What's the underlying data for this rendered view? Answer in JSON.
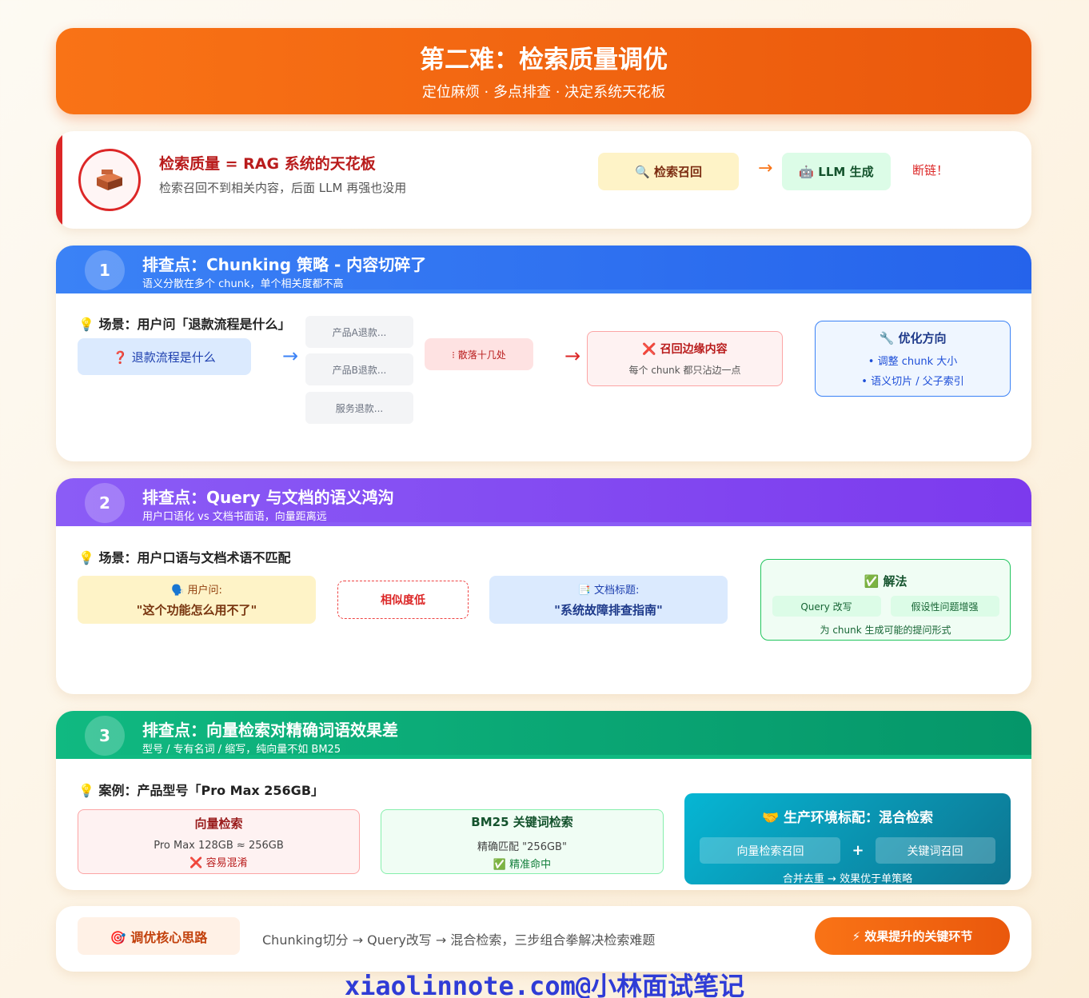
{
  "header": {
    "title": "第二难：检索质量调优",
    "subtitle": "定位麻烦 · 多点排查 · 决定系统天花板"
  },
  "intro": {
    "icon": "brick-icon",
    "title": "检索质量 = RAG 系统的天花板",
    "desc": "检索召回不到相关内容，后面 LLM 再强也没用",
    "step1": "🔍 检索召回",
    "arrow": "→",
    "step2": "🤖 LLM 生成",
    "broken": "断链！"
  },
  "sections": [
    {
      "num": "1",
      "title": "排查点：Chunking 策略 - 内容切碎了",
      "subtitle": "语义分散在多个 chunk，单个相关度都不高",
      "scene": "💡 场景：用户问「退款流程是什么」",
      "question": "❓ 退款流程是什么",
      "arrow1": "→",
      "fragments": [
        "产品A退款...",
        "产品B退款...",
        "服务退款..."
      ],
      "scatter": "⁝ 散落十几处",
      "arrow2": "→",
      "result_title": "❌ 召回边缘内容",
      "result_desc": "每个 chunk 都只沾边一点",
      "opt_title": "🔧 优化方向",
      "opt_items": [
        "• 调整 chunk 大小",
        "• 语义切片 / 父子索引"
      ]
    },
    {
      "num": "2",
      "title": "排查点：Query 与文档的语义鸿沟",
      "subtitle": "用户口语化 vs 文档书面语，向量距离远",
      "scene": "💡 场景：用户口语与文档术语不匹配",
      "user_label": "🗣️ 用户问:",
      "user_q": "\"这个功能怎么用不了\"",
      "low": "相似度低",
      "doc_label": "📑 文档标题:",
      "doc_title": "\"系统故障排查指南\"",
      "sol_title": "✅ 解法",
      "sol_a": "Query 改写",
      "sol_b": "假设性问题增强",
      "sol_desc": "为 chunk 生成可能的提问形式"
    },
    {
      "num": "3",
      "title": "排查点：向量检索对精确词语效果差",
      "subtitle": "型号 / 专有名词 / 缩写，纯向量不如 BM25",
      "scene": "💡 案例：产品型号「Pro Max 256GB」",
      "vec_title": "向量检索",
      "vec_line": "Pro Max 128GB ≈ 256GB",
      "vec_bad": "❌ 容易混淆",
      "bm_title": "BM25 关键词检索",
      "bm_line": "精确匹配 \"256GB\"",
      "bm_good": "✅ 精准命中",
      "hy_title": "🤝 生产环境标配：混合检索",
      "hy_a": "向量检索召回",
      "hy_plus": "+",
      "hy_b": "关键词召回",
      "hy_desc": "合并去重 → 效果优于单策略"
    }
  ],
  "footer": {
    "badge": "🎯 调优核心思路",
    "text": "Chunking切分 → Query改写 → 混合检索，三步组合拳解决检索难题",
    "button": "⚡ 效果提升的关键环节"
  },
  "watermark": "xiaolinnote.com@小林面试笔记",
  "colors": {
    "orange": "#f97316",
    "blue": "#2563eb",
    "purple": "#7c3aed",
    "green": "#10b981",
    "red": "#dc2626",
    "teal": "#0891b2"
  }
}
